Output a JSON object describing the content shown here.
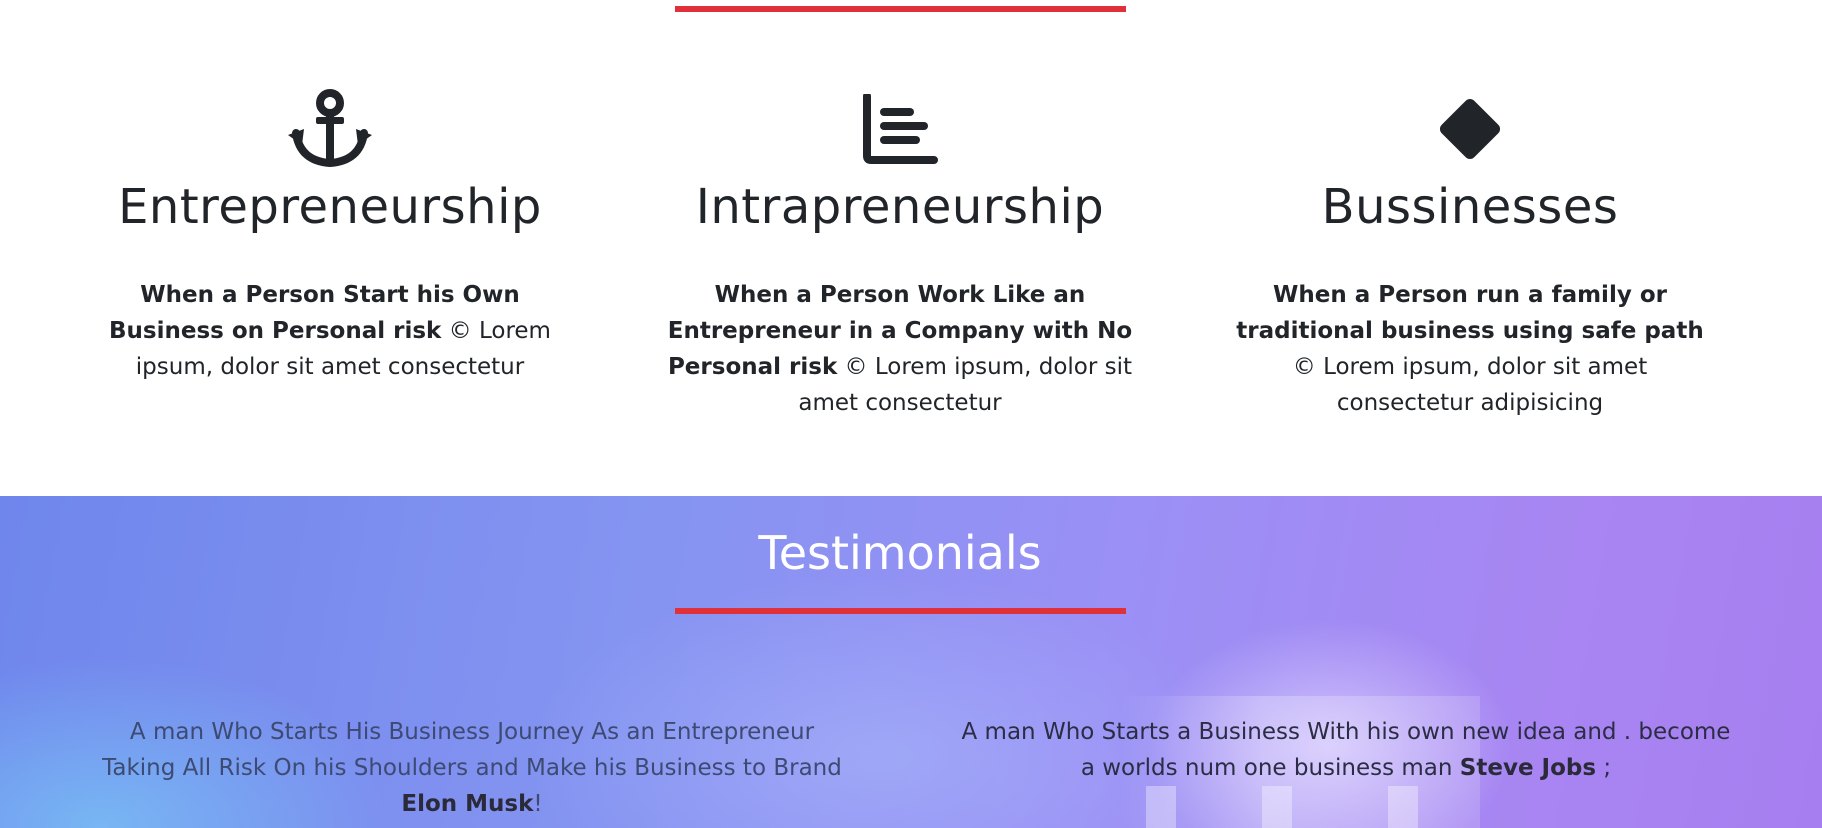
{
  "features": [
    {
      "icon": "anchor-icon",
      "title": "Entrepreneurship",
      "bold": "When a Person Start his Own Business on Personal risk",
      "text": " © Lorem ipsum, dolor sit amet consectetur"
    },
    {
      "icon": "chart-bars-icon",
      "title": "Intrapreneurship",
      "bold": "When a Person Work Like an Entrepreneur in a Company with No Personal risk",
      "text": " © Lorem ipsum, dolor sit amet consectetur"
    },
    {
      "icon": "diamond-icon",
      "title": "Bussinesses",
      "bold": "When a Person run a family or traditional business using safe path",
      "text": " © Lorem ipsum, dolor sit amet consectetur adipisicing"
    }
  ],
  "testimonials": {
    "heading": "Testimonials",
    "quotes": [
      {
        "text": "A man Who Starts His Business Journey As an Entrepreneur Taking All Risk On his Shoulders and Make his Business to Brand ",
        "author": "Elon Musk",
        "suffix": "!"
      },
      {
        "text": "A man Who Starts a Business With his own new idea and . become a worlds num one business man ",
        "author": "Steve Jobs",
        "suffix": " ;"
      }
    ]
  },
  "colors": {
    "accent_rule": "#e0303a",
    "text": "#212529"
  }
}
